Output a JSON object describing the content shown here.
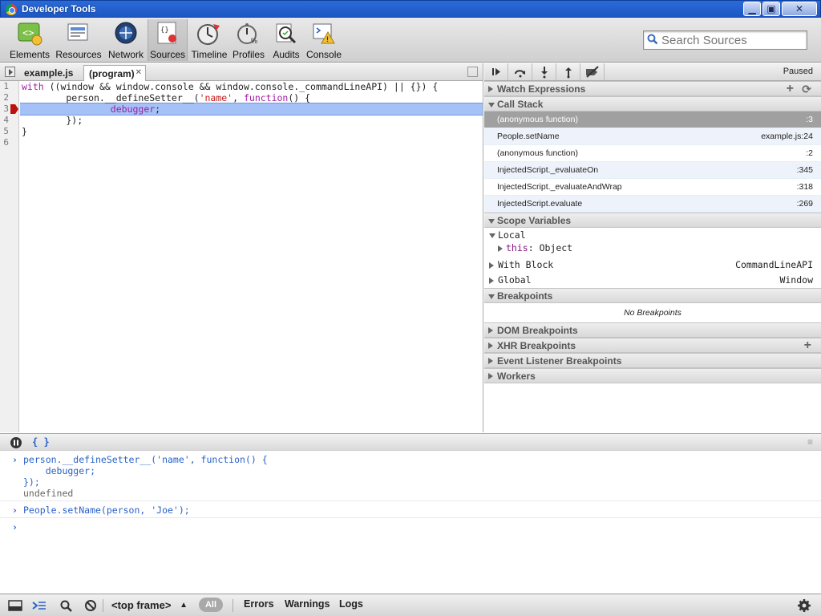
{
  "window": {
    "title": "Developer Tools"
  },
  "toolbar": {
    "items": [
      {
        "label": "Elements",
        "icon": "elements-icon"
      },
      {
        "label": "Resources",
        "icon": "resources-icon"
      },
      {
        "label": "Network",
        "icon": "network-icon"
      },
      {
        "label": "Sources",
        "icon": "sources-icon",
        "selected": true
      },
      {
        "label": "Timeline",
        "icon": "timeline-icon"
      },
      {
        "label": "Profiles",
        "icon": "profiles-icon"
      },
      {
        "label": "Audits",
        "icon": "audits-icon"
      },
      {
        "label": "Console",
        "icon": "console-icon"
      }
    ],
    "search_placeholder": "Search Sources"
  },
  "editor": {
    "tabs": [
      {
        "label": "example.js"
      },
      {
        "label": "(program)",
        "active": true
      }
    ],
    "lines": [
      "1",
      "2",
      "3",
      "4",
      "5",
      "6"
    ],
    "code": {
      "l1": "with ((window && window.console && window.console._commandLineAPI) || {}) {",
      "l2a": "        person.__defineSetter__(",
      "l2b": "'name'",
      "l2c": ", ",
      "l2d": "function",
      "l2e": "() {",
      "l3": "debugger",
      "l3b": ";",
      "l4": "        });",
      "l5": "}",
      "l6": ""
    }
  },
  "debugger": {
    "status": "Paused",
    "sections": {
      "watch": "Watch Expressions",
      "callstack": "Call Stack",
      "scope": "Scope Variables",
      "breakpoints": "Breakpoints",
      "dom_bp": "DOM Breakpoints",
      "xhr_bp": "XHR Breakpoints",
      "event_bp": "Event Listener Breakpoints",
      "workers": "Workers"
    },
    "call_stack": [
      {
        "name": "(anonymous function)",
        "loc": ":3"
      },
      {
        "name": "People.setName",
        "loc": "example.js:24"
      },
      {
        "name": "(anonymous function)",
        "loc": ":2"
      },
      {
        "name": "InjectedScript._evaluateOn",
        "loc": ":345"
      },
      {
        "name": "InjectedScript._evaluateAndWrap",
        "loc": ":318"
      },
      {
        "name": "InjectedScript.evaluate",
        "loc": ":269"
      }
    ],
    "scope": {
      "local": "Local",
      "this_name": "this",
      "this_sep": ": ",
      "this_val": "Object",
      "with_block": "With Block",
      "with_val": "CommandLineAPI",
      "global": "Global",
      "global_val": "Window"
    },
    "no_breakpoints": "No Breakpoints"
  },
  "console": {
    "entries": {
      "c1_l1": "person.__defineSetter__('name', function() {",
      "c1_l2": "    debugger;",
      "c1_l3": "});",
      "c1_res": "undefined",
      "c2_l1": "People.setName(person, 'Joe');"
    }
  },
  "statusbar": {
    "frame": "<top frame>",
    "filter_all": "All",
    "filter_errors": "Errors",
    "filter_warnings": "Warnings",
    "filter_logs": "Logs"
  }
}
